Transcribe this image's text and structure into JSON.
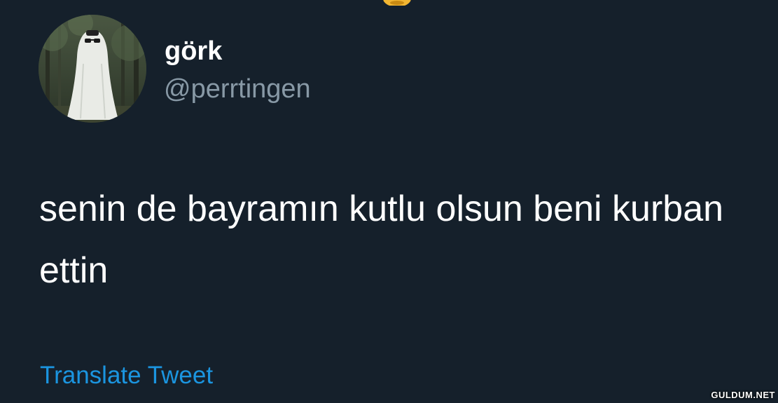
{
  "tweet": {
    "display_name": "görk",
    "handle": "@perrtingen",
    "text": "senin de bayramın kutlu olsun beni kurban ettin",
    "translate_label": "Translate Tweet"
  },
  "avatar": {
    "icon": "ghost-sheet-avatar"
  },
  "watermark": {
    "text": "GULDUM.NET"
  },
  "colors": {
    "background": "#15202b",
    "primary_text": "#ffffff",
    "secondary_text": "#8899a6",
    "link": "#1b95e0"
  }
}
